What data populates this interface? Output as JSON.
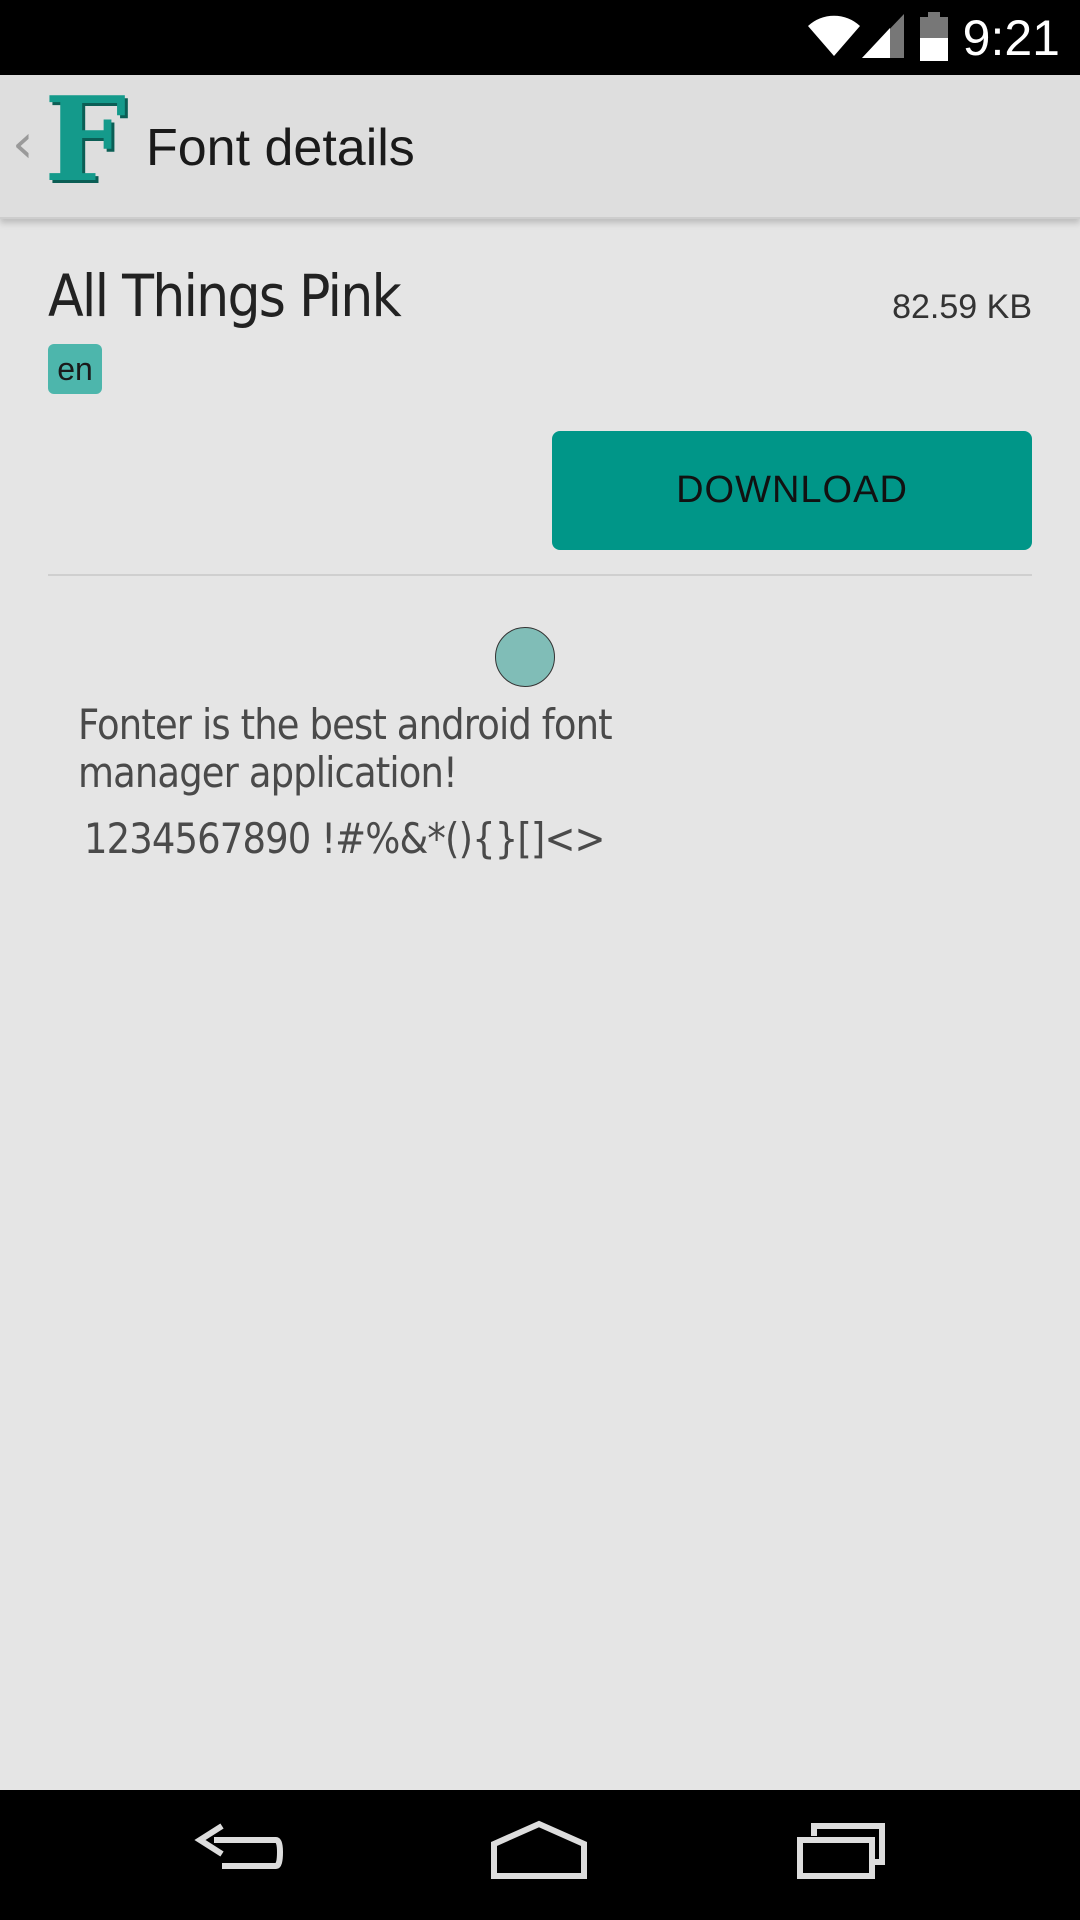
{
  "status_bar": {
    "time": "9:21",
    "icons": [
      "wifi-icon",
      "cell-signal-icon",
      "battery-icon"
    ]
  },
  "app_bar": {
    "back_icon": "chevron-left-icon",
    "logo_letter": "F",
    "title": "Font details"
  },
  "font": {
    "name": "All Things Pink",
    "size": "82.59 KB",
    "language": "en"
  },
  "actions": {
    "download_label": "DOWNLOAD"
  },
  "preview": {
    "line1": "Fonter is the best android font",
    "line2": "manager application!",
    "line3": "1234567890 !#%&*(){}[]<>"
  },
  "nav_bar": {
    "icons": [
      "back-icon",
      "home-icon",
      "recents-icon"
    ]
  },
  "colors": {
    "accent": "#009688",
    "badge": "#4db6ac",
    "logo": "#149a8b",
    "background": "#e5e5e5",
    "app_bar": "#dedede"
  }
}
